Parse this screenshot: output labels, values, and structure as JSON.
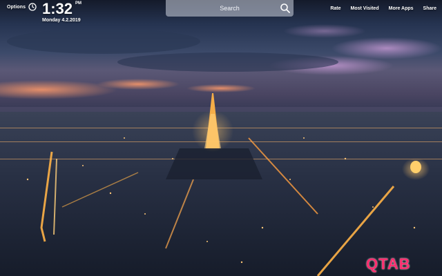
{
  "header": {
    "options_label": "Options",
    "time": "1:32",
    "ampm": "PM",
    "date": "Monday  4.2.2019",
    "clock_icon": "clock-icon"
  },
  "search": {
    "placeholder": "Search",
    "icon": "search-icon"
  },
  "nav": {
    "items": [
      "Rate",
      "Most Visited",
      "More Apps",
      "Share"
    ]
  },
  "logo": {
    "text": "QTAB",
    "color": "#ff2d6f"
  },
  "background": {
    "description_colors": {
      "sky_top": "#1c2438",
      "sky_mid": "#3a4a6e",
      "horizon_glow": "#e88a6a",
      "purple_cloud": "#b88bc4",
      "city": "#1a2233",
      "city_light": "#ffb347"
    }
  }
}
